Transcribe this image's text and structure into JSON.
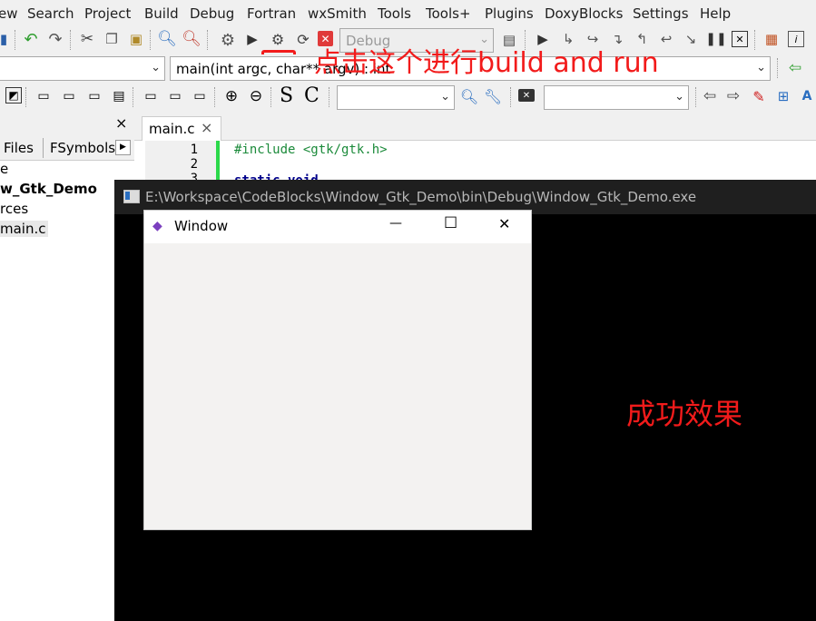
{
  "menu": [
    "ew",
    "Search",
    "Project",
    "Build",
    "Debug",
    "Fortran",
    "wxSmith",
    "Tools",
    "Tools+",
    "Plugins",
    "DoxyBlocks",
    "Settings",
    "Help"
  ],
  "toolbar": {
    "build_target_value": "Debug",
    "function_combo_value": "main(int argc, char** argv) : int",
    "letter_s": "S",
    "letter_c": "C"
  },
  "annotations": {
    "build_run_hint": "点击这个进行build and run",
    "success": "成功效果"
  },
  "left_panel": {
    "close": "×",
    "tabs": [
      "Files",
      "FSymbols"
    ],
    "tree": [
      "e",
      "w_Gtk_Demo",
      "rces",
      "main.c"
    ]
  },
  "editor": {
    "tab_label": "main.c",
    "tab_close": "×",
    "line_numbers": [
      "1",
      "2",
      "3"
    ],
    "lines": [
      "#include <gtk/gtk.h>",
      "",
      "static void"
    ]
  },
  "console": {
    "title": "E:\\Workspace\\CodeBlocks\\Window_Gtk_Demo\\bin\\Debug\\Window_Gtk_Demo.exe"
  },
  "gtk_window": {
    "title": "Window",
    "minimize": "—",
    "maximize": "☐",
    "close": "✕"
  },
  "colors": {
    "annotation_red": "#f21b1b",
    "change_bar": "#2bd94a",
    "console_bg": "#000000"
  }
}
